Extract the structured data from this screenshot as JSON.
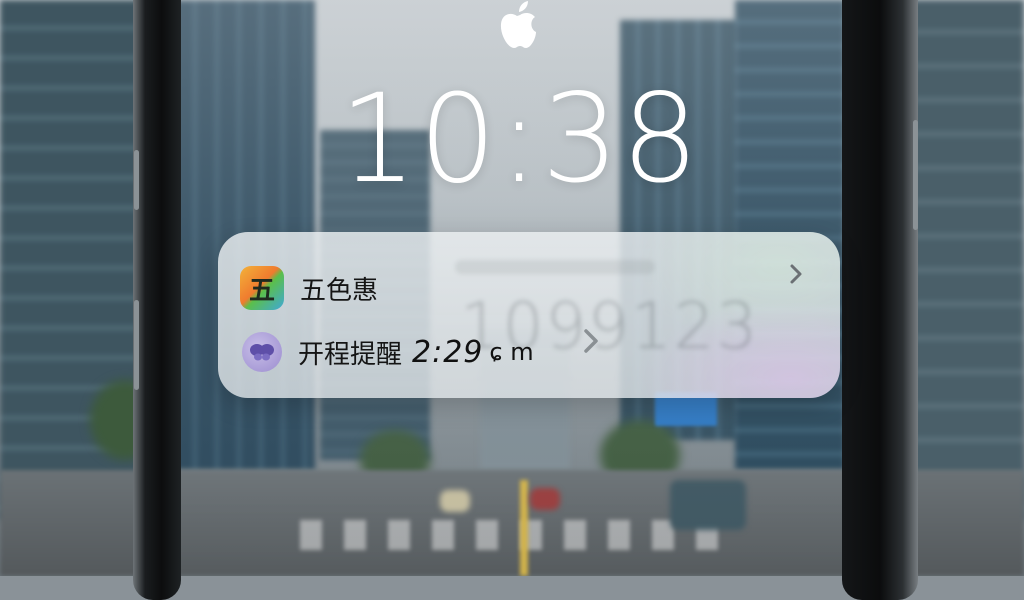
{
  "lock_screen": {
    "time": "10:38",
    "logo": "apple-logo-icon"
  },
  "notification": {
    "app_name": "五色惠",
    "app_icon_glyph": "五",
    "app_icon": "app-icon",
    "message_prefix": "开程提醒",
    "message_time": "2:29",
    "message_unit": "ɕ m",
    "secondary_icon": "butterfly-icon",
    "background_number": "1099123",
    "chevron_icon": "chevron-right-icon"
  },
  "colors": {
    "clock": "#ffffff",
    "notification_bg": "#e6eaec",
    "text": "#151515"
  }
}
